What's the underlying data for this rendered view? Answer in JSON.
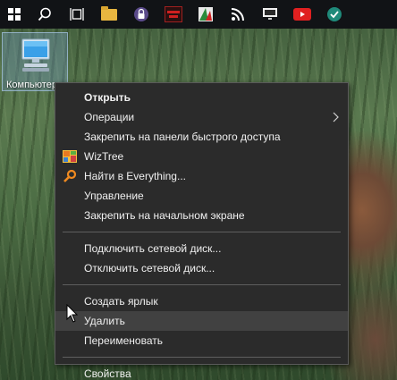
{
  "taskbar": {
    "items": [
      {
        "name": "start-button"
      },
      {
        "name": "search-button"
      },
      {
        "name": "task-view-button"
      },
      {
        "name": "file-explorer-taskbar-icon"
      },
      {
        "name": "app-taskbar-icon-1"
      },
      {
        "name": "app-taskbar-icon-2"
      },
      {
        "name": "app-taskbar-icon-3"
      },
      {
        "name": "app-taskbar-icon-4"
      },
      {
        "name": "app-taskbar-icon-5"
      },
      {
        "name": "youtube-taskbar-icon"
      },
      {
        "name": "app-taskbar-icon-6"
      }
    ]
  },
  "desktop": {
    "icon_label": "Компьютер"
  },
  "context_menu": {
    "open": "Открыть",
    "operations": "Операции",
    "pin_quick_access": "Закрепить на панели быстрого доступа",
    "wiztree": "WizTree",
    "find_everything": "Найти в Everything...",
    "manage": "Управление",
    "pin_start": "Закрепить на начальном экране",
    "map_drive": "Подключить сетевой диск...",
    "disconnect_drive": "Отключить сетевой диск...",
    "create_shortcut": "Создать ярлык",
    "delete": "Удалить",
    "rename": "Переименовать",
    "properties": "Свойства"
  },
  "colors": {
    "menu_bg": "#2b2b2b",
    "menu_hover": "#414141",
    "menu_text": "#f0f0f0",
    "taskbar_bg": "#111316"
  }
}
